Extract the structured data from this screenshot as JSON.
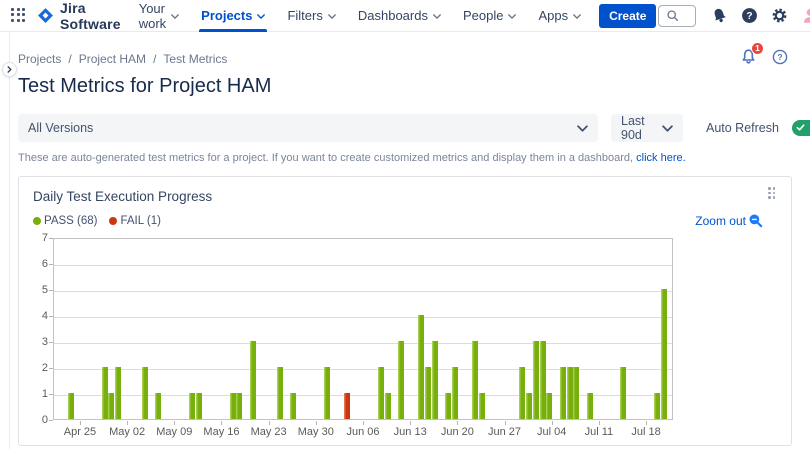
{
  "topnav": {
    "app_name": "Jira Software",
    "items": [
      {
        "label": "Your work"
      },
      {
        "label": "Projects",
        "active": true
      },
      {
        "label": "Filters"
      },
      {
        "label": "Dashboards"
      },
      {
        "label": "People"
      },
      {
        "label": "Apps"
      }
    ],
    "create_label": "Create",
    "search_placeholder": "Search"
  },
  "icons": {
    "help_glyph": "?"
  },
  "page": {
    "breadcrumb": [
      "Projects",
      "Project HAM",
      "Test Metrics"
    ],
    "breadcrumb_sep": "/",
    "title": "Test Metrics for Project HAM",
    "notification_count": "1"
  },
  "filters": {
    "version_selected": "All Versions",
    "range_selected": "Last 90d",
    "auto_refresh_label": "Auto Refresh",
    "auto_refresh_state": "on",
    "note_text": "These are auto-generated test metrics for a project. If you want to create customized metrics and display them in a dashboard,",
    "note_link_text": "click here."
  },
  "panel": {
    "title": "Daily Test Execution Progress",
    "legend": [
      {
        "label": "PASS (68)",
        "color": "#77AF0D"
      },
      {
        "label": "FAIL (1)",
        "color": "#CB3711"
      }
    ],
    "zoom_out_label": "Zoom out"
  },
  "chart_data": {
    "type": "bar",
    "title": "Daily Test Execution Progress",
    "xlabel": "",
    "ylabel": "",
    "ylim": [
      0,
      7
    ],
    "yticks": [
      0,
      1,
      2,
      3,
      4,
      5,
      6,
      7
    ],
    "grid": "horizontal",
    "legend_position": "top-left",
    "x_total_days": 92,
    "x_start_date": "Apr 21",
    "xticks": [
      {
        "label": "Apr 25",
        "day": 4
      },
      {
        "label": "May 02",
        "day": 11
      },
      {
        "label": "May 09",
        "day": 18
      },
      {
        "label": "May 16",
        "day": 25
      },
      {
        "label": "May 23",
        "day": 32
      },
      {
        "label": "May 30",
        "day": 39
      },
      {
        "label": "Jun 06",
        "day": 46
      },
      {
        "label": "Jun 13",
        "day": 53
      },
      {
        "label": "Jun 20",
        "day": 60
      },
      {
        "label": "Jun 27",
        "day": 67
      },
      {
        "label": "Jul 04",
        "day": 74
      },
      {
        "label": "Jul 11",
        "day": 81
      },
      {
        "label": "Jul 18",
        "day": 88
      }
    ],
    "series": [
      {
        "name": "PASS",
        "total": 68,
        "color": "#77AF0D",
        "highlight": "#A6CE53",
        "points": [
          {
            "date": "Apr 23",
            "day": 2,
            "value": 1
          },
          {
            "date": "Apr 28",
            "day": 7,
            "value": 2
          },
          {
            "date": "Apr 29",
            "day": 8,
            "value": 1
          },
          {
            "date": "Apr 30",
            "day": 9,
            "value": 2
          },
          {
            "date": "May 04",
            "day": 13,
            "value": 2
          },
          {
            "date": "May 06",
            "day": 15,
            "value": 1
          },
          {
            "date": "May 11",
            "day": 20,
            "value": 1
          },
          {
            "date": "May 12",
            "day": 21,
            "value": 1
          },
          {
            "date": "May 17",
            "day": 26,
            "value": 1
          },
          {
            "date": "May 18",
            "day": 27,
            "value": 1
          },
          {
            "date": "May 20",
            "day": 29,
            "value": 3
          },
          {
            "date": "May 24",
            "day": 33,
            "value": 2
          },
          {
            "date": "May 26",
            "day": 35,
            "value": 1
          },
          {
            "date": "May 31",
            "day": 40,
            "value": 2
          },
          {
            "date": "Jun 08",
            "day": 48,
            "value": 2
          },
          {
            "date": "Jun 09",
            "day": 49,
            "value": 1
          },
          {
            "date": "Jun 11",
            "day": 51,
            "value": 3
          },
          {
            "date": "Jun 14",
            "day": 54,
            "value": 4
          },
          {
            "date": "Jun 15",
            "day": 55,
            "value": 2
          },
          {
            "date": "Jun 16",
            "day": 56,
            "value": 3
          },
          {
            "date": "Jun 18",
            "day": 58,
            "value": 1
          },
          {
            "date": "Jun 19",
            "day": 59,
            "value": 2
          },
          {
            "date": "Jun 22",
            "day": 62,
            "value": 3
          },
          {
            "date": "Jun 23",
            "day": 63,
            "value": 1
          },
          {
            "date": "Jun 29",
            "day": 69,
            "value": 2
          },
          {
            "date": "Jun 30",
            "day": 70,
            "value": 1
          },
          {
            "date": "Jul 01",
            "day": 71,
            "value": 3
          },
          {
            "date": "Jul 02",
            "day": 72,
            "value": 3
          },
          {
            "date": "Jul 03",
            "day": 73,
            "value": 1
          },
          {
            "date": "Jul 05",
            "day": 75,
            "value": 2
          },
          {
            "date": "Jul 06",
            "day": 76,
            "value": 2
          },
          {
            "date": "Jul 07",
            "day": 77,
            "value": 2
          },
          {
            "date": "Jul 09",
            "day": 79,
            "value": 1
          },
          {
            "date": "Jul 14",
            "day": 84,
            "value": 2
          },
          {
            "date": "Jul 19",
            "day": 89,
            "value": 1
          },
          {
            "date": "Jul 20",
            "day": 90,
            "value": 5
          }
        ]
      },
      {
        "name": "FAIL",
        "total": 1,
        "color": "#CB3711",
        "highlight": "#E0744B",
        "points": [
          {
            "date": "Jun 03",
            "day": 43,
            "value": 1
          }
        ]
      }
    ]
  },
  "colors": {
    "accent_blue": "#0052CC",
    "toggle_green": "#22A06B",
    "badge_red": "#E5493E",
    "pass_green": "#77AF0D",
    "fail_red": "#CB3711"
  }
}
